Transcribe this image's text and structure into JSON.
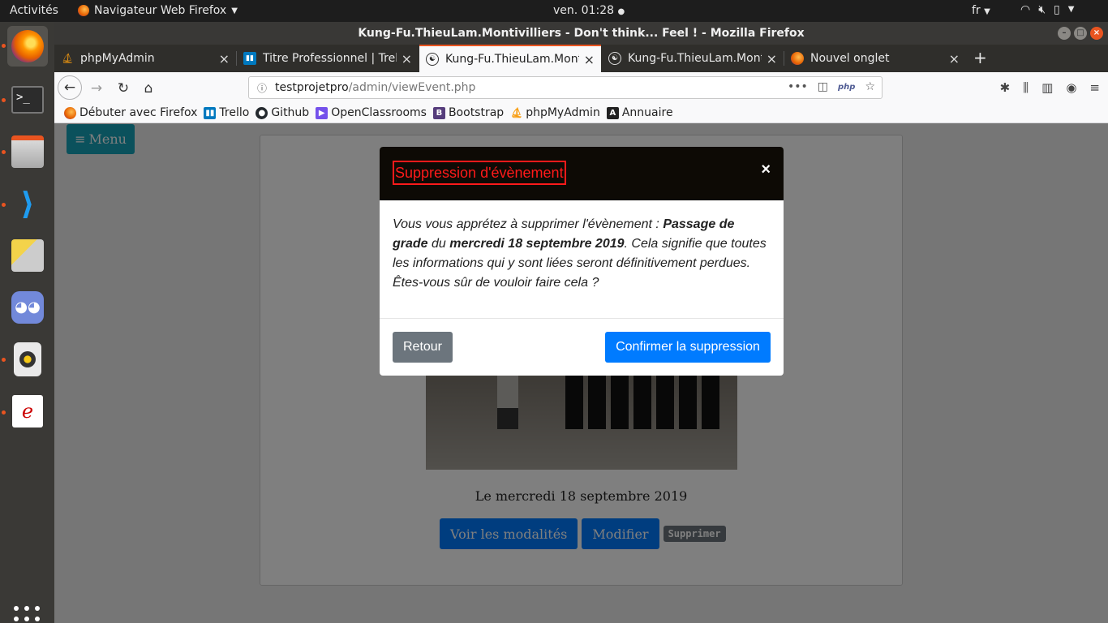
{
  "topbar": {
    "activities": "Activités",
    "app_name": "Navigateur Web Firefox",
    "clock": "ven. 01:28",
    "lang": "fr"
  },
  "window": {
    "title": "Kung-Fu.ThieuLam.Montivilliers - Don't think... Feel ! - Mozilla Firefox"
  },
  "tabs": [
    {
      "label": "phpMyAdmin",
      "icon": "phpmyadmin-icon"
    },
    {
      "label": "Titre Professionnel | Trello",
      "icon": "trello-icon"
    },
    {
      "label": "Kung-Fu.ThieuLam.Montivilliers",
      "icon": "site-icon"
    },
    {
      "label": "Kung-Fu.ThieuLam.Montivilliers",
      "icon": "site-icon"
    },
    {
      "label": "Nouvel onglet",
      "icon": "firefox-icon"
    }
  ],
  "active_tab_index": 2,
  "urlbar": {
    "host": "testprojetpro",
    "path": "/admin/viewEvent.php",
    "php_badge": "php"
  },
  "bookmarks": [
    {
      "label": "Débuter avec Firefox",
      "icon": "firefox-icon",
      "color": "#e66000"
    },
    {
      "label": "Trello",
      "icon": "trello-icon",
      "color": "#0079bf"
    },
    {
      "label": "Github",
      "icon": "github-icon",
      "color": "#24292e"
    },
    {
      "label": "OpenClassrooms",
      "icon": "openclassrooms-icon",
      "color": "#7451eb"
    },
    {
      "label": "Bootstrap",
      "icon": "bootstrap-icon",
      "color": "#563d7c"
    },
    {
      "label": "phpMyAdmin",
      "icon": "phpmyadmin-icon",
      "color": "#f89c0e"
    },
    {
      "label": "Annuaire",
      "icon": "annuaire-icon",
      "color": "#222222"
    }
  ],
  "page": {
    "menu_label": "Menu",
    "event_date": "Le mercredi 18 septembre 2019",
    "btn_modalites": "Voir les modalités",
    "btn_modifier": "Modifier",
    "btn_supprimer": "Supprimer"
  },
  "modal": {
    "title": "Suppression d'évènement",
    "close": "×",
    "text_1": "Vous vous apprétez à supprimer l'évènement : ",
    "event_name": "Passage de grade",
    "text_2": " du ",
    "event_date": "mercredi 18 septembre 2019",
    "text_3": ". Cela signifie que toutes les informations qui y sont liées seront définitivement perdues. Êtes-vous sûr de vouloir faire cela ?",
    "btn_back": "Retour",
    "btn_confirm": "Confirmer la suppression"
  },
  "colors": {
    "accent": "#e95420",
    "primary": "#007bff",
    "secondary": "#6c757d",
    "info": "#17a2b8",
    "danger_title": "#ff1a1a"
  }
}
